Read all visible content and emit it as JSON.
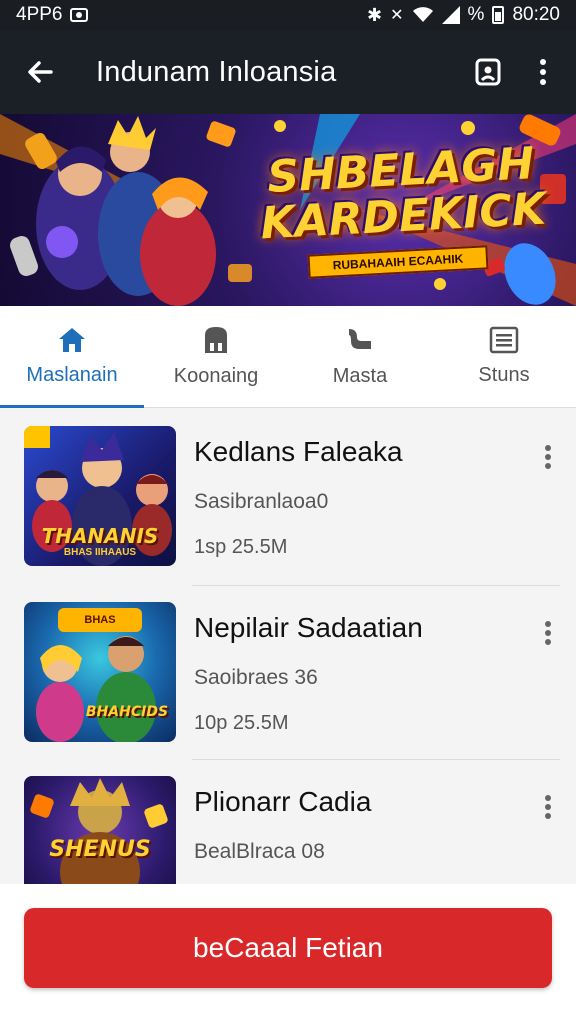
{
  "status_bar": {
    "time_left": "4PP6",
    "right_text": "%",
    "clock": "80:20"
  },
  "app_bar": {
    "title": "Indunam Inloansia",
    "back_icon": "back-arrow-icon",
    "bookmark_icon": "bookmark-icon",
    "more_icon": "more-vert-icon"
  },
  "banner": {
    "title_line1": "SHBELAGH",
    "title_line2": "KARDEKICK",
    "subtitle": "RUBAHAAIH ECAAHIK"
  },
  "tabs": [
    {
      "label": "Maslanain",
      "icon": "home-icon",
      "active": true
    },
    {
      "label": "Koonaing",
      "icon": "storage-icon",
      "active": false
    },
    {
      "label": "Masta",
      "icon": "pipe-icon",
      "active": false
    },
    {
      "label": "Stuns",
      "icon": "list-icon",
      "active": false
    }
  ],
  "items": [
    {
      "title": "Kedlans Faleaka",
      "subtitle": "Sasibranlaoa0",
      "size": "1sp  25.5M",
      "thumb_text": "THANANIS",
      "thumb_sub": "BHAS IIHAAUS"
    },
    {
      "title": "Nepilair Sadaatian",
      "subtitle": "Saoibraes 36",
      "size": "10p  25.5M",
      "thumb_text": "BHAHCIDS",
      "thumb_sub": "BHAS"
    },
    {
      "title": "Plionarr Cadia",
      "subtitle": "BealBlraca 08",
      "size": "",
      "thumb_text": "SHENUS",
      "thumb_sub": ""
    }
  ],
  "cta": {
    "label": "beCaaal Fetian"
  },
  "colors": {
    "accent": "#1e6fb8",
    "cta": "#d8282a",
    "app_bar": "#1b1f26"
  }
}
